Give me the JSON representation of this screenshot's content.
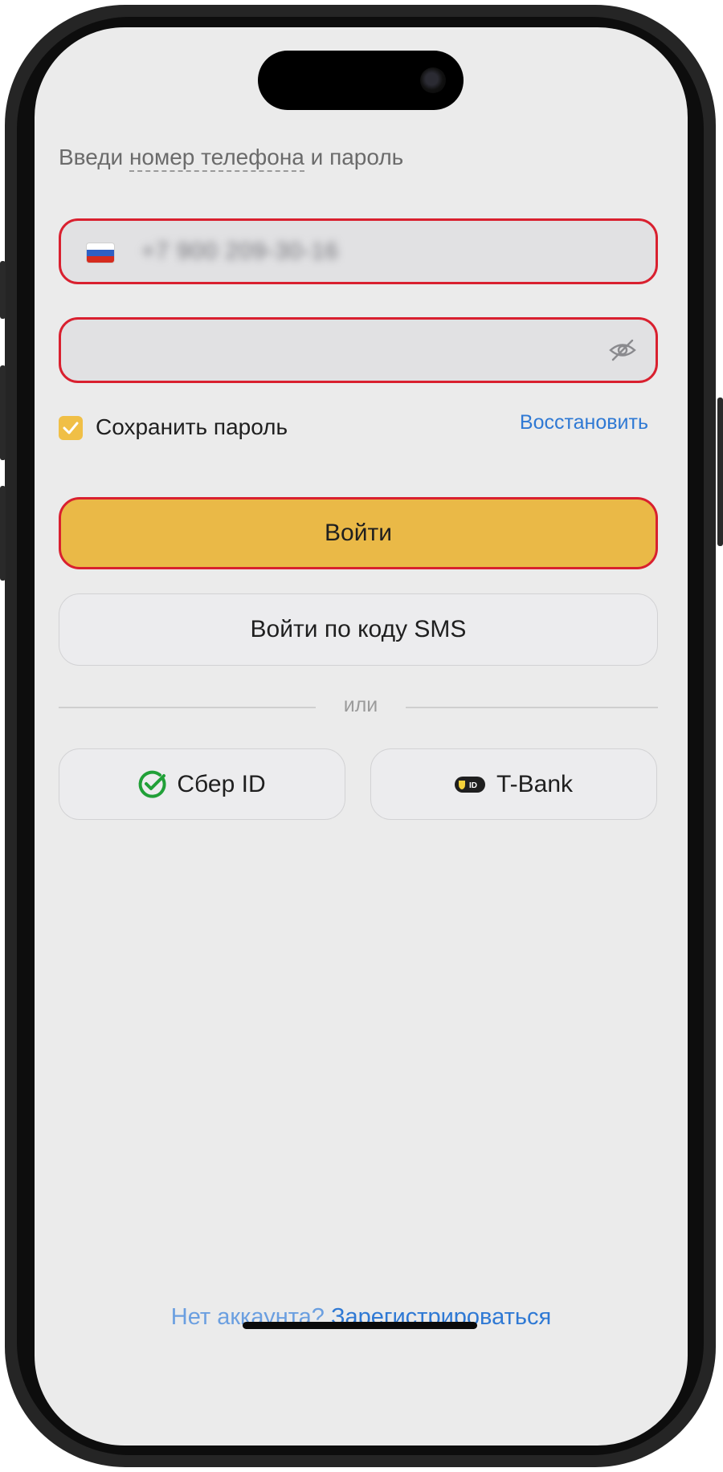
{
  "login": {
    "prompt_before": "Введи ",
    "prompt_link": "номер телефона",
    "prompt_after": " и пароль",
    "phone_value": "+7 900 209-30-16",
    "password_value": "",
    "save_password_label": "Сохранить пароль",
    "save_password_checked": true,
    "restore_label": "Восстановить",
    "login_button": "Войти",
    "sms_button": "Войти по коду SMS",
    "divider_text": "или",
    "sber_label": "Сбер ID",
    "tbank_label": "T-Bank",
    "tbank_badge": "ID",
    "footer_question": "Нет аккаунта?",
    "footer_link": "Зарегистрироваться"
  },
  "icons": {
    "flag": "russia-flag-icon",
    "eye": "eye-off-icon",
    "check": "check-icon",
    "sber": "sber-logo-icon",
    "tbank": "tbank-logo-icon"
  },
  "colors": {
    "background": "#ebebeb",
    "accent_yellow": "#eab947",
    "error_red": "#d9202f",
    "link_blue": "#2f79d4",
    "sber_green": "#21a038"
  }
}
